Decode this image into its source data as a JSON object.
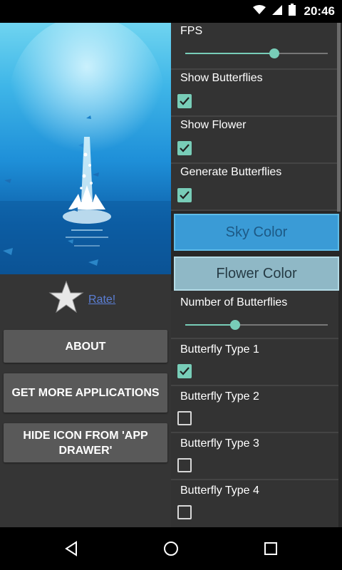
{
  "status_bar": {
    "time": "20:46"
  },
  "left": {
    "rate_label": "Rate!",
    "buttons": {
      "about": "ABOUT",
      "get_more": "GET MORE APPLICATIONS",
      "hide_icon": "HIDE ICON FROM 'APP DRAWER'"
    }
  },
  "settings": {
    "fps": {
      "label": "FPS",
      "level": 0.62
    },
    "show_butterflies": {
      "label": "Show Butterflies",
      "checked": true
    },
    "show_flower": {
      "label": "Show Flower",
      "checked": true
    },
    "generate_butterflies": {
      "label": "Generate Butterflies",
      "checked": true
    },
    "sky_color": {
      "label": "Sky Color"
    },
    "flower_color": {
      "label": "Flower Color"
    },
    "number_of_butterflies": {
      "label": "Number of Butterflies",
      "level": 0.35
    },
    "butterfly_type_1": {
      "label": "Butterfly Type 1",
      "checked": true
    },
    "butterfly_type_2": {
      "label": "Butterfly Type 2",
      "checked": false
    },
    "butterfly_type_3": {
      "label": "Butterfly Type 3",
      "checked": false
    },
    "butterfly_type_4": {
      "label": "Butterfly Type 4",
      "checked": false
    }
  },
  "colors": {
    "accent": "#78cdb8",
    "sky_button": "#3a9bd6",
    "flower_button": "#8fb8c6"
  },
  "icons": [
    "wifi-icon",
    "signal-icon",
    "battery-icon",
    "star-icon",
    "check-icon",
    "back-icon",
    "home-icon",
    "recents-icon"
  ]
}
